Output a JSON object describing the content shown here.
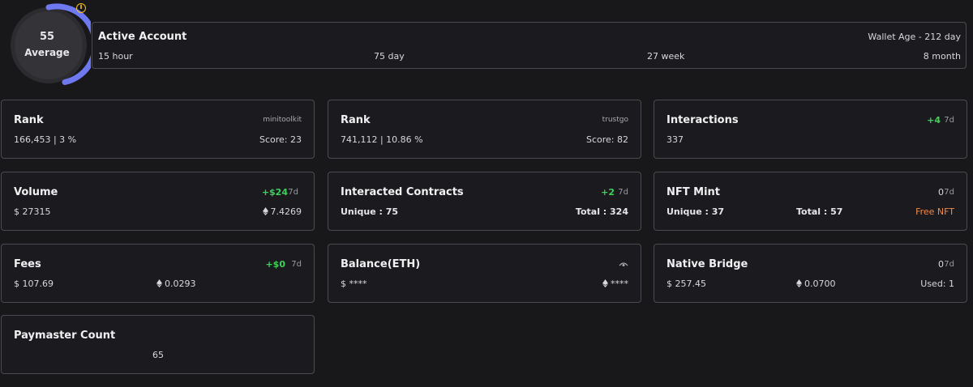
{
  "score": {
    "value": "55",
    "label": "Average",
    "info_icon": "info-icon",
    "ring_fill": 0.55,
    "ring_color": "#6e78f0"
  },
  "active_account": {
    "title": "Active Account",
    "wallet_age": "Wallet Age - 212 day",
    "stats": [
      "15 hour",
      "75 day",
      "27 week",
      "8 month"
    ]
  },
  "rank_minitoolkit": {
    "title": "Rank",
    "source": "minitoolkit",
    "value": "166,453 | 3 %",
    "score": "Score: 23"
  },
  "rank_trustgo": {
    "title": "Rank",
    "source": "trustgo",
    "value": "741,112 | 10.86 %",
    "score": "Score: 82"
  },
  "interactions": {
    "title": "Interactions",
    "change": "+4",
    "period": "7d",
    "value": "337"
  },
  "volume": {
    "title": "Volume",
    "change": "+$24",
    "period": "7d",
    "usd": "$ 27315",
    "eth": "7.4269"
  },
  "interacted_contracts": {
    "title": "Interacted Contracts",
    "change": "+2",
    "period": "7d",
    "unique": "Unique : 75",
    "total": "Total : 324"
  },
  "nft_mint": {
    "title": "NFT Mint",
    "change": "0",
    "period": "7d",
    "unique": "Unique : 37",
    "total": "Total : 57",
    "free": "Free NFT"
  },
  "fees": {
    "title": "Fees",
    "change": "+$0",
    "period": "7d",
    "usd": "$ 107.69",
    "eth": "0.0293"
  },
  "balance": {
    "title": "Balance(ETH)",
    "usd": "$ ****",
    "eth": "****"
  },
  "native_bridge": {
    "title": "Native Bridge",
    "change": "0",
    "period": "7d",
    "usd": "$ 257.45",
    "eth": "0.0700",
    "used": "Used: 1"
  },
  "paymaster": {
    "title": "Paymaster Count",
    "value": "65"
  },
  "colors": {
    "green": "#3fcf5a",
    "orange": "#f08a4b",
    "accent": "#6e78f0",
    "border": "#4a4a52"
  }
}
